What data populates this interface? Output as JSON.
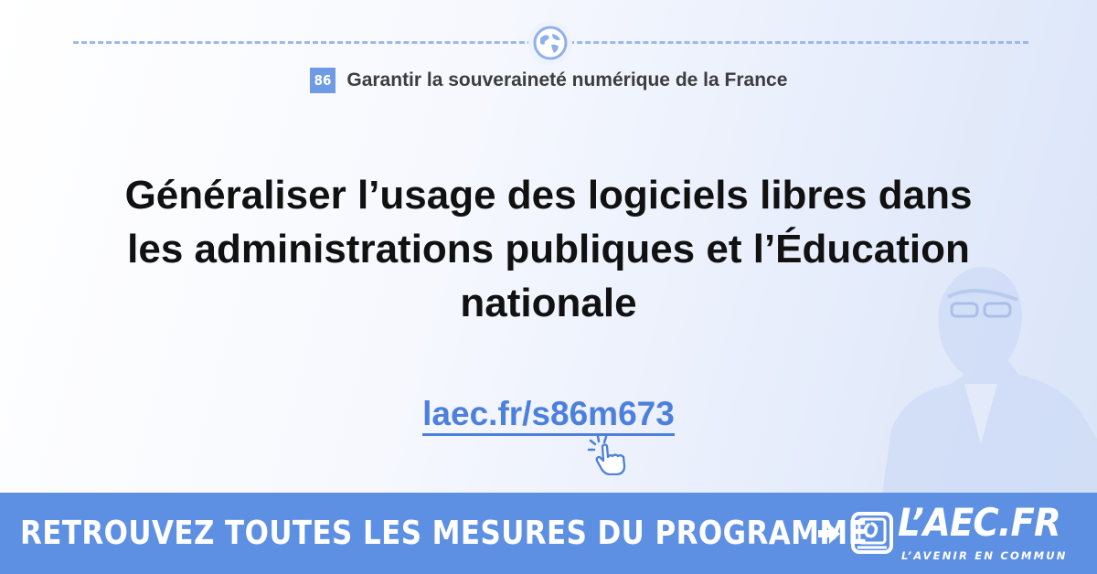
{
  "chapter": {
    "number": "86",
    "title": "Garantir la souveraineté numérique de la France"
  },
  "headline": {
    "lines": [
      "Généraliser l’usage des logiciels libres dans",
      "les administrations publiques et l’Éducation",
      "nationale"
    ]
  },
  "link": {
    "text": "laec.fr/s86m673"
  },
  "banner": {
    "cta": "RETROUVEZ TOUTES LES MESURES DU PROGRAMME",
    "logo_name": "L’AEC.FR",
    "logo_tagline": "L’AVENIR EN COMMUN"
  },
  "icons": {
    "top": "globe-icon",
    "link": "pointer-hand-icon",
    "cta": "arrow-right-icon",
    "logo": "book-logo-icon"
  },
  "colors": {
    "accent": "#5d8fe3",
    "link": "#4d7fdc",
    "text": "#111111",
    "chapter_badge": "#6f9be6"
  }
}
